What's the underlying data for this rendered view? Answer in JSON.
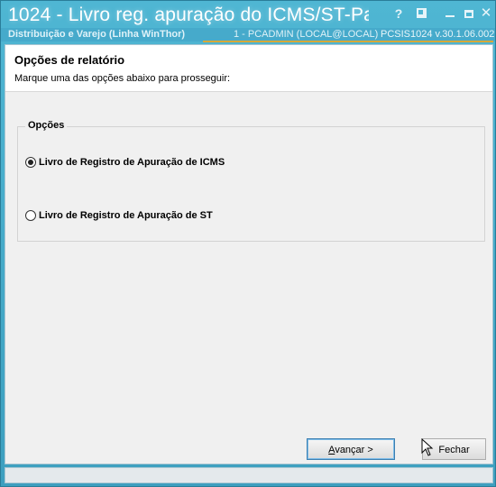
{
  "window": {
    "title": "1024 - Livro reg. apuração do ICMS/ST-Pa",
    "subtitle_left": "Distribuição e Varejo (Linha WinThor)",
    "subtitle_user": "1 - PCADMIN (LOCAL@LOCAL)",
    "subtitle_version": "PCSIS1024  v.30.1.06.002",
    "help_label": "?",
    "accent_color": "#d6a93a"
  },
  "header": {
    "title": "Opções de relatório",
    "description": "Marque uma das opções abaixo para prosseguir:"
  },
  "options": {
    "legend": "Opções",
    "items": [
      {
        "label": "Livro de Registro de Apuração de ICMS",
        "checked": true
      },
      {
        "label": "Livro de Registro de Apuração de ST",
        "checked": false
      }
    ]
  },
  "buttons": {
    "next_mnemonic": "A",
    "next_rest": "vançar >",
    "close_label": "Fechar"
  }
}
